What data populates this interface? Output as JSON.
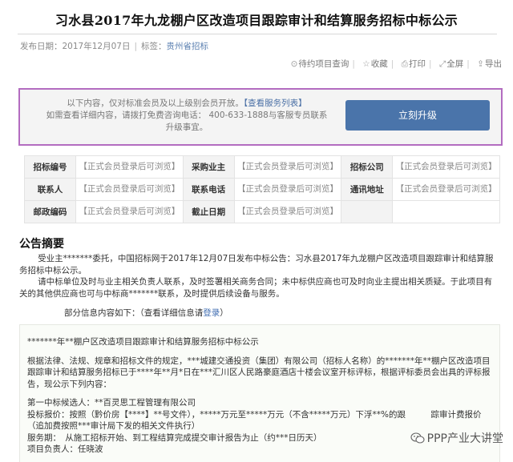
{
  "page": {
    "title": "习水县2017年九龙棚户区改造项目跟踪审计和结算服务招标中标公示"
  },
  "meta": {
    "date_label": "发布日期：",
    "date_value": "2017年12月07日",
    "source_label": "标签：",
    "source_value": "贵州省招标"
  },
  "toolbar": {
    "items": [
      {
        "icon": "document-icon",
        "label": "待约项目查询"
      },
      {
        "icon": "star-icon",
        "label": "收藏"
      },
      {
        "icon": "print-icon",
        "label": "打印"
      },
      {
        "icon": "fullscreen-icon",
        "label": "全屏"
      },
      {
        "icon": "export-icon",
        "label": "导出"
      }
    ]
  },
  "upgrade": {
    "line1_pre": "以下内容，仅对标准会员及以上级别会员开放。",
    "line1_link": "【查看服务列表】",
    "line2": "如需查看详细内容，请拨打免费咨询电话：  400-633-1888与客服专员联系升级事宜。",
    "button_label": "立刻升级"
  },
  "info_table": {
    "rows": [
      [
        {
          "key": "招标编号",
          "value": "【正式会员登录后可浏览】"
        },
        {
          "key": "采购业主",
          "value": "【正式会员登录后可浏览】"
        },
        {
          "key": "招标公司",
          "value": "【正式会员登录后可浏览】"
        }
      ],
      [
        {
          "key": "联系人",
          "value": "【正式会员登录后可浏览】"
        },
        {
          "key": "联系电话",
          "value": "【正式会员登录后可浏览】"
        },
        {
          "key": "通讯地址",
          "value": "【正式会员登录后可浏览】"
        }
      ],
      [
        {
          "key": "邮政编码",
          "value": "【正式会员登录后可浏览】"
        },
        {
          "key": "截止日期",
          "value": "【正式会员登录后可浏览】"
        },
        {
          "key": "",
          "value": ""
        }
      ]
    ]
  },
  "summary": {
    "title": "公告摘要",
    "p1": "受业主*******委托，中国招标网于2017年12月07日发布中标公告：习水县2017年九龙棚户区改造项目跟踪审计和结算服务招标中标公示。",
    "p2": "请中标单位及时与业主相关负责人联系，及时签署相关商务合同；未中标供应商也可及时向业主提出相关质疑。于此项目有关的其他供应商也可与中标商*******联系，及时提供后续设备与服务。",
    "more_pre": "部分信息内容如下：（查看详细信息请",
    "more_link": "登录",
    "more_post": "）"
  },
  "content": {
    "heading": "*******年**棚户区改造项目跟踪审计和结算服务招标中标公示",
    "intro": "根据法律、法规、规章和招标文件的规定，***城建交通投资（集团）有限公司（招标人名称）的*******年**棚户区改造项目跟踪审计和结算服务招标已于****年**月*日在***汇川区人民路豪庭酒店十楼会议室开标评标，根据评标委员会出具的评标报告，现公示下列内容：",
    "candidate": "第一中标候选人：**百灵思工程管理有限公司",
    "quote": "投标报价：按照（黔价房【****】**号文件），*****万元至*****万元（不含*****万元）下浮**%的跟　　　踪审计费报价（追加费按照***审计局下发的相关文件执行）",
    "service": "服务期：　从施工招标开始、到工程结算完成提交审计报告为止（约***日历天）",
    "manager": "项目负责人：任晓波"
  },
  "watermark": {
    "text": "PPP产业大讲堂"
  }
}
